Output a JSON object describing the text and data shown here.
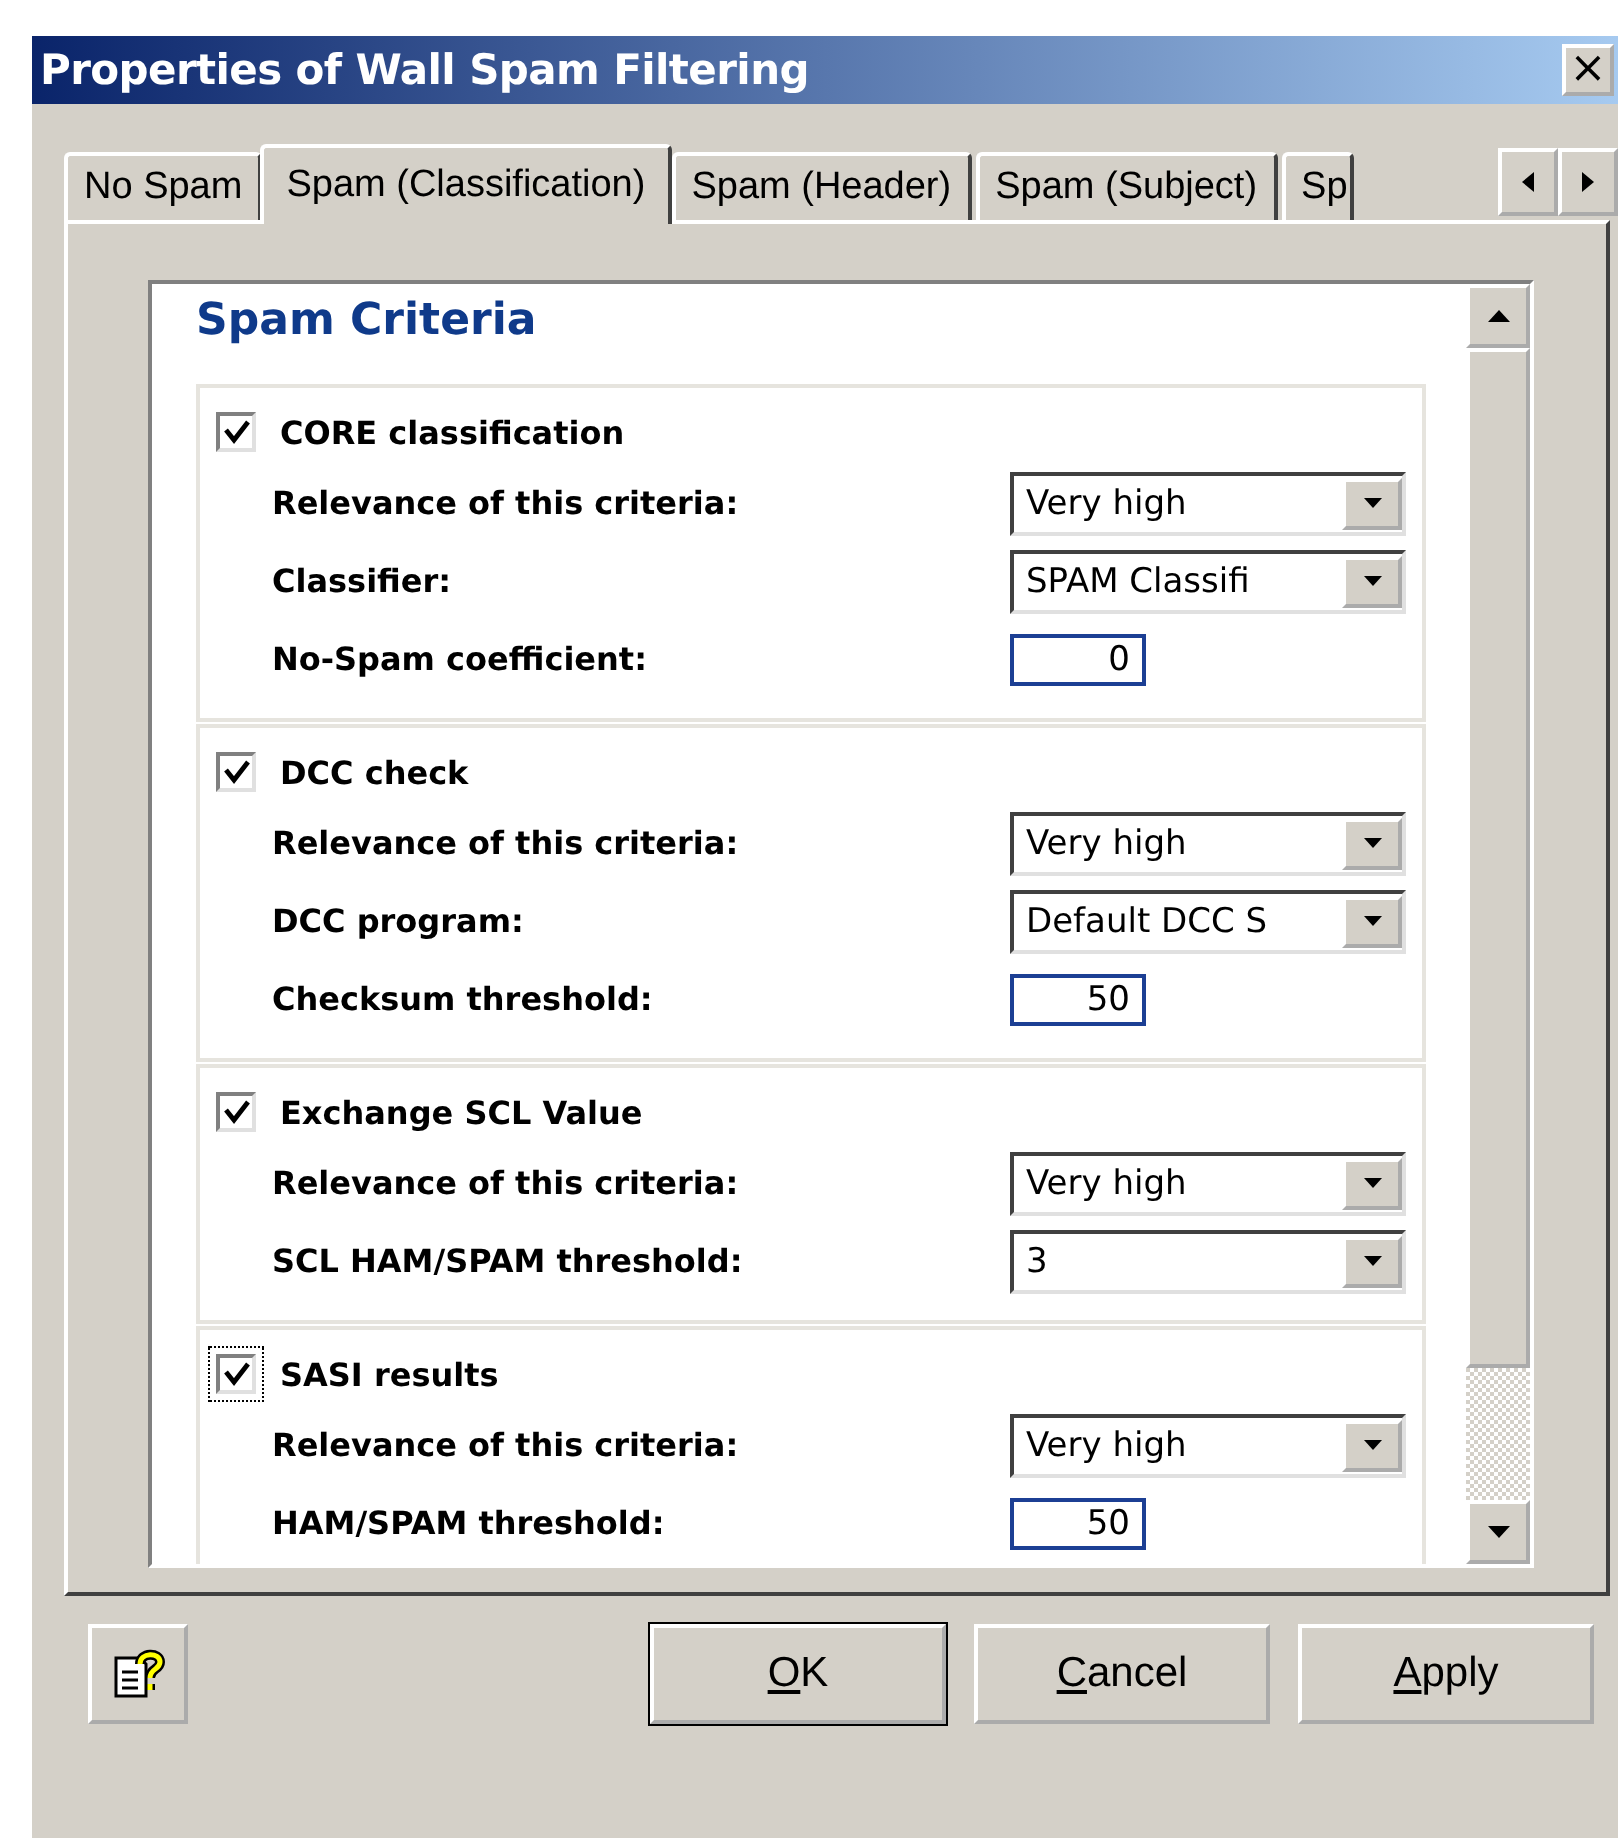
{
  "window": {
    "title": "Properties of Wall Spam Filtering",
    "close": "×"
  },
  "tabs": [
    {
      "label": "No Spam",
      "selected": false
    },
    {
      "label": "Spam (Classification)",
      "selected": true
    },
    {
      "label": "Spam (Header)",
      "selected": false
    },
    {
      "label": "Spam (Subject)",
      "selected": false
    },
    {
      "label": "Sp",
      "selected": false
    }
  ],
  "heading": "Spam Criteria",
  "sections": [
    {
      "title": "CORE classification",
      "checked": true,
      "focused": false,
      "rows": [
        {
          "kind": "dropdown",
          "label": "Relevance of this criteria:",
          "value": "Very high"
        },
        {
          "kind": "dropdown",
          "label": "Classifier:",
          "value": "SPAM Classifi"
        },
        {
          "kind": "number",
          "label": "No-Spam coefficient:",
          "value": "0"
        }
      ]
    },
    {
      "title": "DCC check",
      "checked": true,
      "focused": false,
      "rows": [
        {
          "kind": "dropdown",
          "label": "Relevance of this criteria:",
          "value": "Very high"
        },
        {
          "kind": "dropdown",
          "label": "DCC program:",
          "value": "Default DCC S"
        },
        {
          "kind": "number",
          "label": "Checksum threshold:",
          "value": "50"
        }
      ]
    },
    {
      "title": "Exchange SCL Value",
      "checked": true,
      "focused": false,
      "rows": [
        {
          "kind": "dropdown",
          "label": "Relevance of this criteria:",
          "value": "Very high"
        },
        {
          "kind": "dropdown",
          "label": "SCL HAM/SPAM threshold:",
          "value": "3"
        }
      ]
    },
    {
      "title": "SASI results",
      "checked": true,
      "focused": true,
      "rows": [
        {
          "kind": "dropdown",
          "label": "Relevance of this criteria:",
          "value": "Very high"
        },
        {
          "kind": "number",
          "label": "HAM/SPAM threshold:",
          "value": "50"
        }
      ]
    }
  ],
  "buttons": [
    {
      "label": "OK",
      "default": true
    },
    {
      "label": "Cancel",
      "default": false
    },
    {
      "label": "Apply",
      "default": false
    }
  ]
}
